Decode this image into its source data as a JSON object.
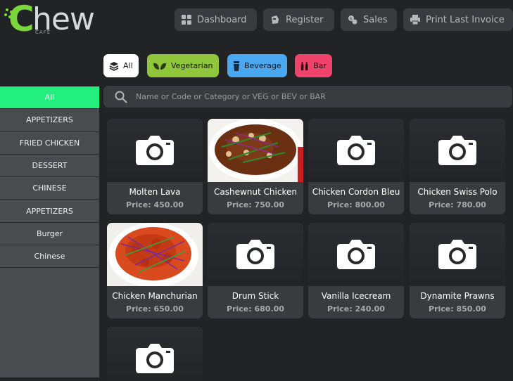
{
  "header": {
    "logo": {
      "main": "Chew",
      "sub": "CAFE"
    },
    "buttons": {
      "dashboard": "Dashboard",
      "register": "Register",
      "sales": "Sales",
      "print": "Print Last Invoice"
    }
  },
  "filters": {
    "all": "All",
    "veg": "Vegetarian",
    "bev": "Beverage",
    "bar": "Bar"
  },
  "sidebar": {
    "items": [
      {
        "label": "All",
        "active": true
      },
      {
        "label": "APPETIZERS"
      },
      {
        "label": "FRIED CHICKEN"
      },
      {
        "label": "DESSERT"
      },
      {
        "label": "CHINESE"
      },
      {
        "label": "APPETIZERS"
      },
      {
        "label": "Burger"
      },
      {
        "label": "Chinese"
      }
    ]
  },
  "search": {
    "placeholder": "Name or Code or Category or VEG or BEV or BAR",
    "value": ""
  },
  "products": [
    {
      "name": "Molten Lava",
      "price": "Price: 450.00",
      "image": "camera-placeholder"
    },
    {
      "name": "Cashewnut Chicken",
      "price": "Price: 750.00",
      "image": "photo-cashewnut"
    },
    {
      "name": "Chicken Cordon Bleu",
      "price": "Price: 800.00",
      "image": "camera-placeholder"
    },
    {
      "name": "Chicken Swiss Polo",
      "price": "Price: 780.00",
      "image": "camera-placeholder"
    },
    {
      "name": "Chicken Manchurian",
      "price": "Price: 650.00",
      "image": "photo-manchurian"
    },
    {
      "name": "Drum Stick",
      "price": "Price: 680.00",
      "image": "camera-placeholder"
    },
    {
      "name": "Vanilla Icecream",
      "price": "Price: 240.00",
      "image": "camera-placeholder"
    },
    {
      "name": "Dynamite Prawns",
      "price": "Price: 850.00",
      "image": "camera-placeholder"
    },
    {
      "name": "",
      "price": "",
      "image": "camera-placeholder"
    }
  ],
  "colors": {
    "background": "#222325",
    "sidebar": "#4a4b4f",
    "active": "#22ef7e",
    "vegetarian": "#8fc63a",
    "beverage": "#4aa8f0",
    "bar": "#f0436b",
    "logo_green": "#7ad83a"
  }
}
